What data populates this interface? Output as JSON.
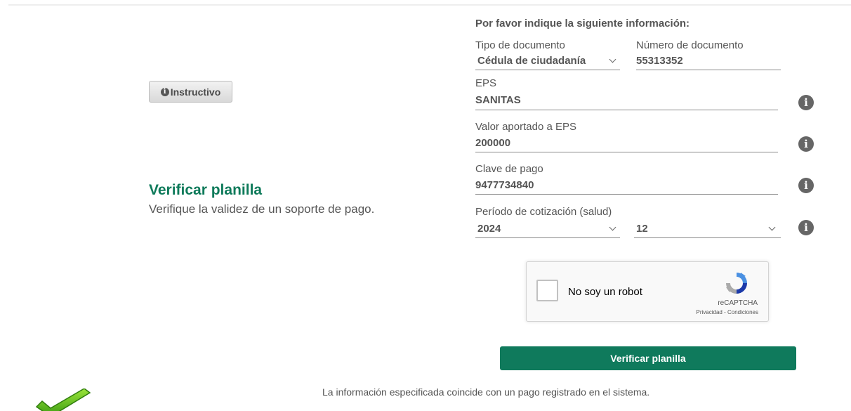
{
  "instructivo": {
    "label": "Instructivo",
    "icon": "info-circle-icon"
  },
  "page": {
    "title": "Verificar planilla",
    "subtitle": "Verifique la validez de un soporte de pago."
  },
  "form": {
    "heading": "Por favor indique la siguiente información:",
    "tipo_documento": {
      "label": "Tipo de documento",
      "value": "Cédula de ciudadanía"
    },
    "numero_documento": {
      "label": "Número de documento",
      "value": "55313352"
    },
    "eps": {
      "label": "EPS",
      "value": "SANITAS"
    },
    "valor_aportado": {
      "label": "Valor aportado a EPS",
      "value": "200000"
    },
    "clave_pago": {
      "label": "Clave de pago",
      "value": "9477734840"
    },
    "periodo": {
      "label": "Período de cotización (salud)",
      "year": "2024",
      "month": "12"
    },
    "info_icon_glyph": "i"
  },
  "recaptcha": {
    "label": "No soy un robot",
    "brand": "reCAPTCHA",
    "links": "Privacidad - Condiciones"
  },
  "submit": {
    "label": "Verificar planilla"
  },
  "result": {
    "message": "La información especificada coincide con un pago registrado en el sistema.",
    "icon": "green-checkmark-icon"
  },
  "colors": {
    "accent": "#0f7a5c",
    "title": "#0e7a5a",
    "text": "#555555"
  }
}
